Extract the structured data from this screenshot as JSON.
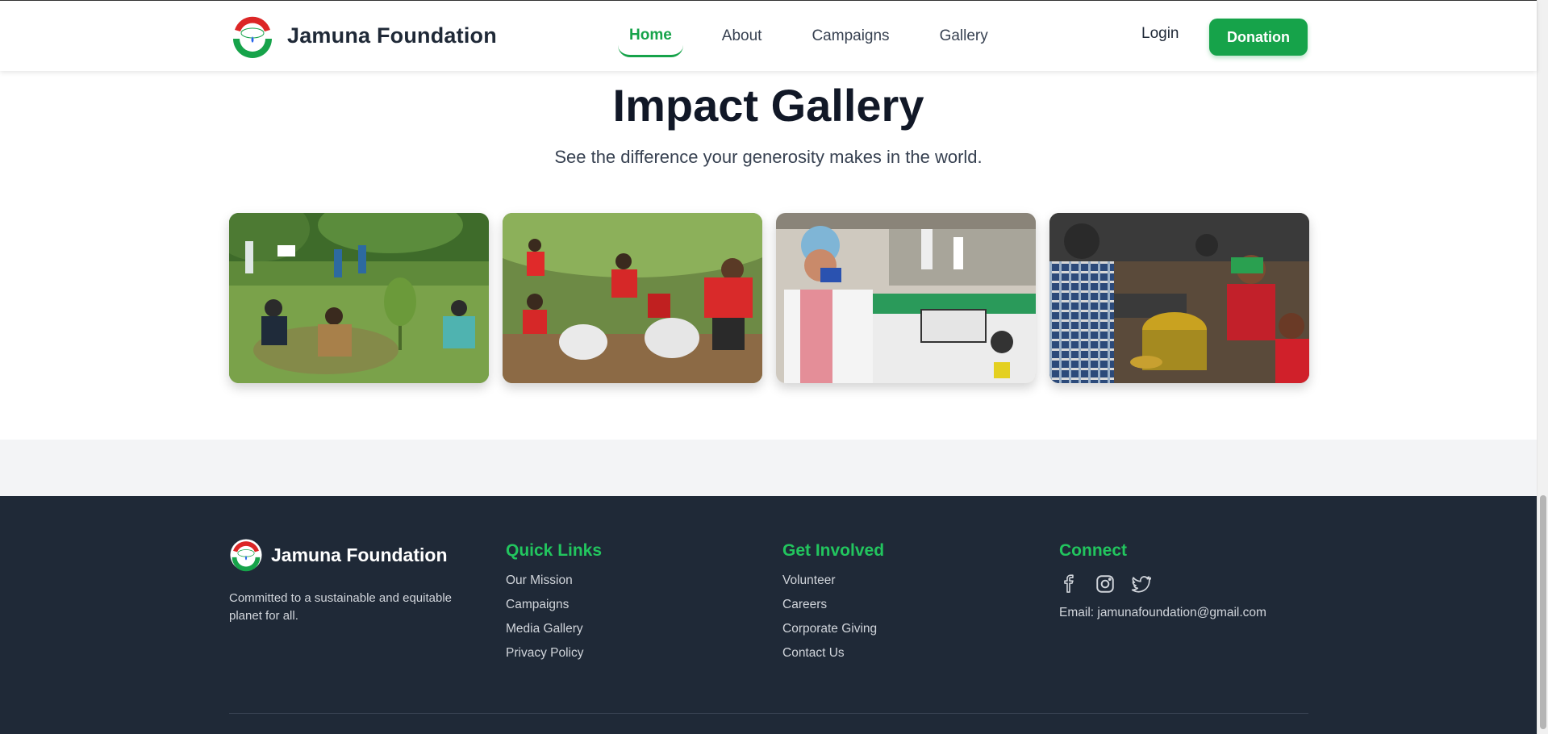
{
  "header": {
    "brand": "Jamuna Foundation",
    "nav": [
      "Home",
      "About",
      "Campaigns",
      "Gallery"
    ],
    "active_nav": "Home",
    "login": "Login",
    "donate": "Donation"
  },
  "gallery": {
    "title": "Impact Gallery",
    "subtitle": "See the difference your generosity makes in the world."
  },
  "footer": {
    "brand": "Jamuna Foundation",
    "description": "Committed to a sustainable and equitable planet for all.",
    "quick_links": {
      "title": "Quick Links",
      "items": [
        "Our Mission",
        "Campaigns",
        "Media Gallery",
        "Privacy Policy"
      ]
    },
    "get_involved": {
      "title": "Get Involved",
      "items": [
        "Volunteer",
        "Careers",
        "Corporate Giving",
        "Contact Us"
      ]
    },
    "connect": {
      "title": "Connect",
      "socials": [
        "facebook-icon",
        "instagram-icon",
        "twitter-icon"
      ],
      "email": "Email: jamunafoundation@gmail.com"
    }
  },
  "colors": {
    "accent": "#16a34a",
    "footer_bg": "#1f2937",
    "footer_heading": "#22c55e"
  }
}
